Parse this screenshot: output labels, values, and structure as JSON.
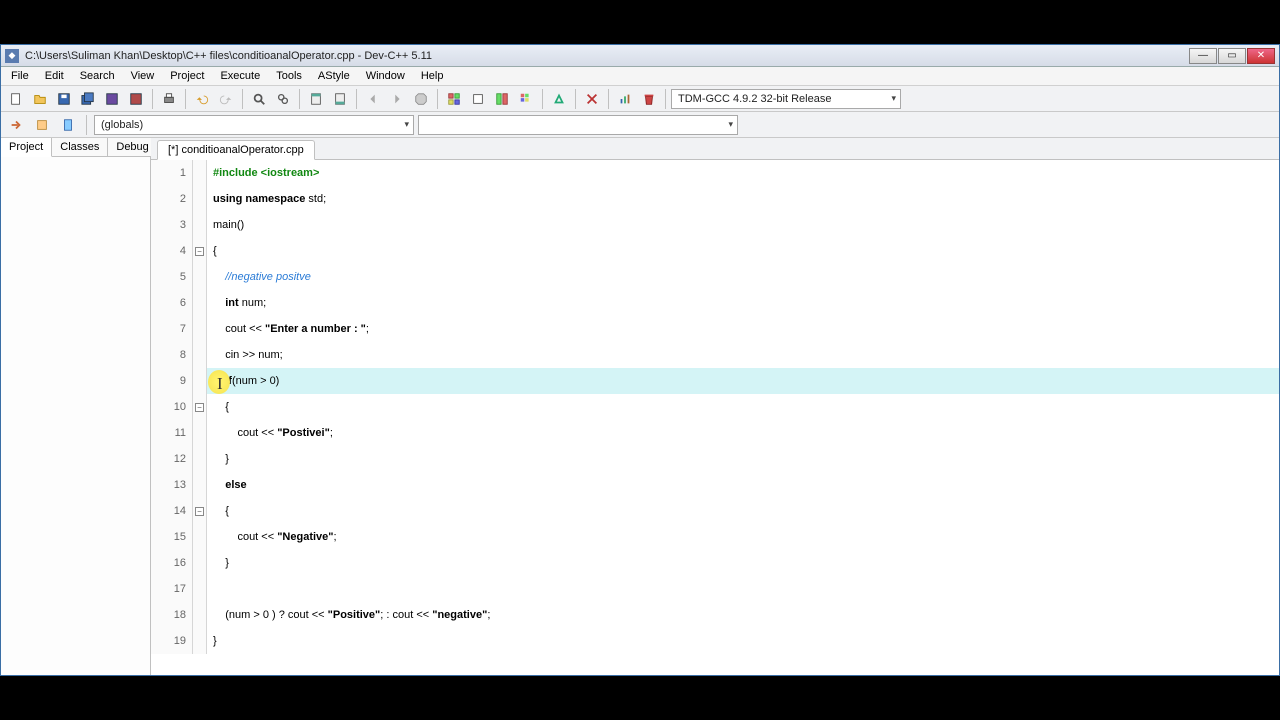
{
  "title": "C:\\Users\\Suliman Khan\\Desktop\\C++ files\\conditioanalOperator.cpp - Dev-C++ 5.11",
  "menu": [
    "File",
    "Edit",
    "Search",
    "View",
    "Project",
    "Execute",
    "Tools",
    "AStyle",
    "Window",
    "Help"
  ],
  "compiler_select": "TDM-GCC 4.9.2 32-bit Release",
  "scope_select": "(globals)",
  "left_tabs": [
    "Project",
    "Classes",
    "Debug"
  ],
  "editor_tab": "[*] conditioanalOperator.cpp",
  "code": {
    "l1": {
      "n": "1",
      "pre": "#include",
      "rest": " <iostream>"
    },
    "l2": {
      "n": "2",
      "kw1": "using",
      "kw2": "namespace",
      "id": " std;"
    },
    "l3": {
      "n": "3",
      "t": "main()"
    },
    "l4": {
      "n": "4",
      "t": "{"
    },
    "l5": {
      "n": "5",
      "cmt": "    //negative positve"
    },
    "l6": {
      "n": "6",
      "pad": "    ",
      "kw": "int",
      "rest": " num;"
    },
    "l7": {
      "n": "7",
      "t": "    cout << ",
      "s": "\"Enter a number : \"",
      "e": ";"
    },
    "l8": {
      "n": "8",
      "t": "    cin >> num;"
    },
    "l9": {
      "n": "9",
      "pad": "    ",
      "kw": "if",
      "rest": "(num > 0)"
    },
    "l10": {
      "n": "10",
      "t": "    {"
    },
    "l11": {
      "n": "11",
      "t": "        cout << ",
      "s": "\"Postivei\"",
      "e": ";"
    },
    "l12": {
      "n": "12",
      "t": "    }"
    },
    "l13": {
      "n": "13",
      "pad": "    ",
      "kw": "else"
    },
    "l14": {
      "n": "14",
      "t": "    {"
    },
    "l15": {
      "n": "15",
      "t": "        cout << ",
      "s": "\"Negative\"",
      "e": ";"
    },
    "l16": {
      "n": "16",
      "t": "    }"
    },
    "l17": {
      "n": "17",
      "t": ""
    },
    "l18": {
      "n": "18",
      "a": "    (num > 0 ) ? cout << ",
      "s1": "\"Positive\"",
      "b": "; : cout << ",
      "s2": "\"negative\"",
      "c": ";"
    },
    "l19": {
      "n": "19",
      "t": "}"
    }
  }
}
